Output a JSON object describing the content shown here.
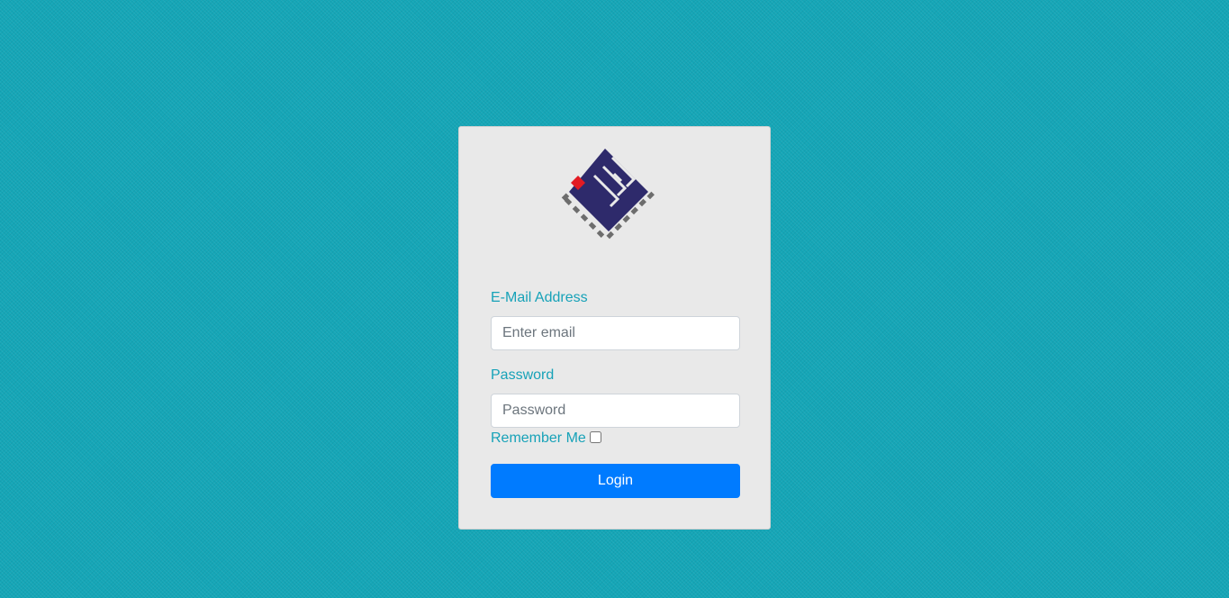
{
  "login_form": {
    "email_label": "E-Mail Address",
    "email_placeholder": "Enter email",
    "email_value": "",
    "password_label": "Password",
    "password_placeholder": "Password",
    "password_value": "",
    "remember_label": "Remember Me",
    "remember_checked": false,
    "login_label": "Login"
  },
  "colors": {
    "background": "#15a6b7",
    "label": "#17a2b8",
    "button": "#007bff",
    "logo_primary": "#2e2a6b",
    "logo_accent": "#e31b23",
    "logo_pins": "#6d6d6d"
  },
  "icons": {
    "logo": "chip-logo-icon"
  }
}
